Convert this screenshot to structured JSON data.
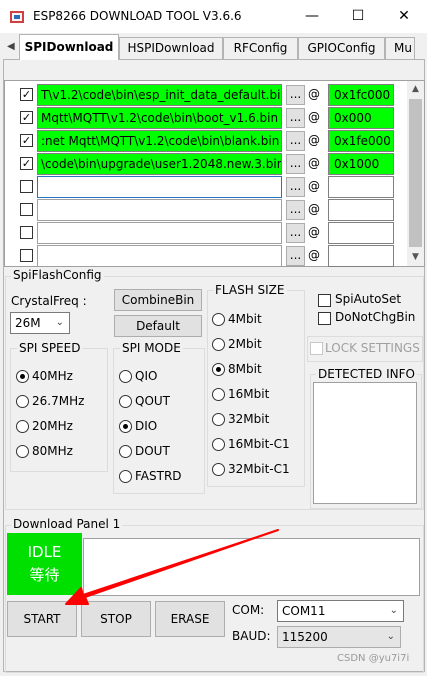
{
  "window": {
    "title": "ESP8266 DOWNLOAD TOOL V3.6.6",
    "minimize_glyph": "—",
    "maximize_glyph": "☐",
    "close_glyph": "✕"
  },
  "tabs": [
    {
      "label": "SPIDownload",
      "active": true
    },
    {
      "label": "HSPIDownload",
      "active": false
    },
    {
      "label": "RFConfig",
      "active": false
    },
    {
      "label": "GPIOConfig",
      "active": false
    },
    {
      "label": "Mu",
      "active": false
    }
  ],
  "tab_scroll_left": "◀",
  "files": [
    {
      "checked": true,
      "path": "T\\v1.2\\code\\bin\\esp_init_data_default.bin",
      "address": "0x1fc000"
    },
    {
      "checked": true,
      "path": "Mqtt\\MQTT\\v1.2\\code\\bin\\boot_v1.6.bin",
      "address": "0x000"
    },
    {
      "checked": true,
      "path": ":net Mqtt\\MQTT\\v1.2\\code\\bin\\blank.bin",
      "address": "0x1fe000"
    },
    {
      "checked": true,
      "path": "\\code\\bin\\upgrade\\user1.2048.new.3.bin",
      "address": "0x1000"
    },
    {
      "checked": false,
      "path": "",
      "address": ""
    },
    {
      "checked": false,
      "path": "",
      "address": ""
    },
    {
      "checked": false,
      "path": "",
      "address": ""
    },
    {
      "checked": false,
      "path": "",
      "address": ""
    }
  ],
  "browse_label": "...",
  "at_label": "@",
  "check_mark": "✓",
  "spi_flash_config": {
    "title": "SpiFlashConfig",
    "crystal_label": "CrystalFreq :",
    "crystal_value": "26M",
    "combine_bin": "CombineBin",
    "default": "Default",
    "flash_size_title": "FLASH SIZE",
    "flash_sizes": [
      {
        "label": "4Mbit",
        "selected": false
      },
      {
        "label": "2Mbit",
        "selected": false
      },
      {
        "label": "8Mbit",
        "selected": true
      },
      {
        "label": "16Mbit",
        "selected": false
      },
      {
        "label": "32Mbit",
        "selected": false
      },
      {
        "label": "16Mbit-C1",
        "selected": false
      },
      {
        "label": "32Mbit-C1",
        "selected": false
      }
    ],
    "spi_autoset": "SpiAutoSet",
    "do_not_chg_bin": "DoNotChgBin",
    "lock_settings": "LOCK SETTINGS",
    "detected_info": "DETECTED INFO",
    "spi_speed_title": "SPI SPEED",
    "spi_speeds": [
      {
        "label": "40MHz",
        "selected": true
      },
      {
        "label": "26.7MHz",
        "selected": false
      },
      {
        "label": "20MHz",
        "selected": false
      },
      {
        "label": "80MHz",
        "selected": false
      }
    ],
    "spi_mode_title": "SPI MODE",
    "spi_modes": [
      {
        "label": "QIO",
        "selected": false
      },
      {
        "label": "QOUT",
        "selected": false
      },
      {
        "label": "DIO",
        "selected": true
      },
      {
        "label": "DOUT",
        "selected": false
      },
      {
        "label": "FASTRD",
        "selected": false
      }
    ]
  },
  "download_panel": {
    "title": "Download Panel 1",
    "status_en": "IDLE",
    "status_cn": "等待",
    "status_color": "#00e000",
    "start": "START",
    "stop": "STOP",
    "erase": "ERASE",
    "com_label": "COM:",
    "com_value": "COM11",
    "baud_label": "BAUD:",
    "baud_value": "115200"
  },
  "annotation_arrow_color": "#ff0000",
  "watermark": "CSDN @yu7i7i"
}
